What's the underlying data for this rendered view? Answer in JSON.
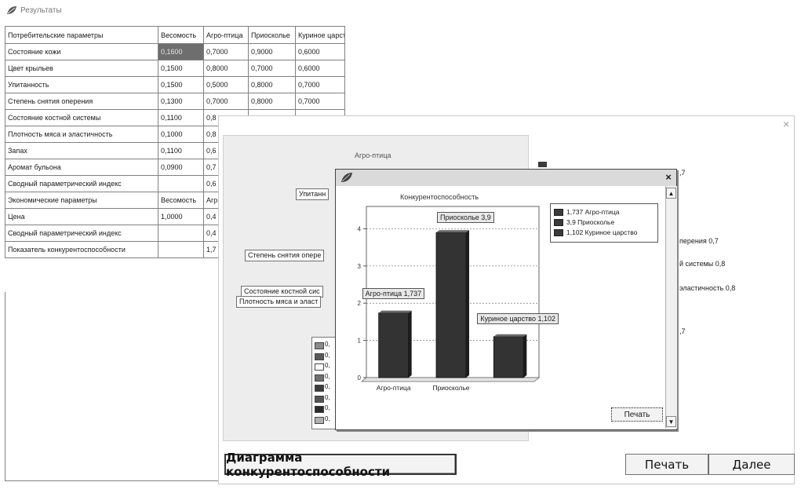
{
  "window": {
    "title": "Результаты"
  },
  "table": {
    "header": [
      "Потребительские параметры",
      "Весомость",
      "Агро-птица",
      "Приосколье",
      "Куриное царство"
    ],
    "rows": [
      [
        "Состояние кожи",
        "0,1600",
        "0,7000",
        "0,9000",
        "0,6000"
      ],
      [
        "Цвет крыльев",
        "0,1500",
        "0,8000",
        "0,7000",
        "0,6000"
      ],
      [
        "Упитанность",
        "0,1500",
        "0,5000",
        "0,8000",
        "0,7000"
      ],
      [
        "Степень снятия оперения",
        "0,1300",
        "0,7000",
        "0,8000",
        "0,7000"
      ],
      [
        "Состояние костной системы",
        "0,1100",
        "0,8",
        "",
        ""
      ],
      [
        "Плотность мяса и эластичность",
        "0,1000",
        "0,8",
        "",
        ""
      ],
      [
        "Запах",
        "0,1100",
        "0,6",
        "",
        ""
      ],
      [
        "Аромат бульона",
        "0,0900",
        "0,7",
        "",
        ""
      ],
      [
        "Сводный параметрический индекс",
        "",
        "0,6",
        "",
        ""
      ],
      [
        "Экономические параметры",
        "Весомость",
        "Агр",
        "",
        ""
      ],
      [
        "Цена",
        "1,0000",
        "0,4",
        "",
        ""
      ],
      [
        "Сводный параметрический индекс",
        "",
        "0,4",
        "",
        ""
      ],
      [
        "Показатель конкурентоспособности",
        "",
        "1,7",
        "",
        ""
      ]
    ]
  },
  "panel": {
    "close": "×",
    "chart_title": "Агро-птица",
    "labels": [
      "Упитанн",
      "Степень снятия опере",
      "Состояние костной сис",
      "Плотность мяса и эласт"
    ],
    "legend_items": [
      "0,",
      "0,",
      "0,",
      "0,",
      "0,",
      "0,",
      "0,",
      "0,"
    ],
    "right_values": [
      ",7",
      "перения 0,7",
      "й системы 0,8",
      "эластичность 0,8",
      ",7"
    ],
    "buttons": {
      "diagram": "Диаграмма конкурентоспособности",
      "print": "Печать",
      "next": "Далее"
    }
  },
  "popup": {
    "close": "×",
    "print_button": "Печать",
    "scroll_up": "▲",
    "scroll_down": "▼"
  },
  "chart_data": {
    "type": "bar",
    "title": "Конкурентоспособность",
    "categories": [
      "Агро-птица",
      "Приосколье",
      "Куриное царство"
    ],
    "tick_labels_x": [
      "Агро-птица",
      "Приосколье"
    ],
    "values": [
      1.737,
      3.9,
      1.102
    ],
    "data_labels": [
      "Агро-птица 1,737",
      "Приосколье 3,9",
      "Куриное царство 1,102"
    ],
    "legend": [
      "1,737 Агро-птица",
      "3,9 Приосколье",
      "1,102 Куриное царство"
    ],
    "ylim": [
      0,
      4.6
    ],
    "yticks": [
      0,
      1,
      2,
      3,
      4
    ],
    "grid": true,
    "legend_position": "right",
    "colors": {
      "bar": "#333333",
      "bar_side": "#1c1c1c",
      "bar_top": "#6a6a6a"
    }
  }
}
